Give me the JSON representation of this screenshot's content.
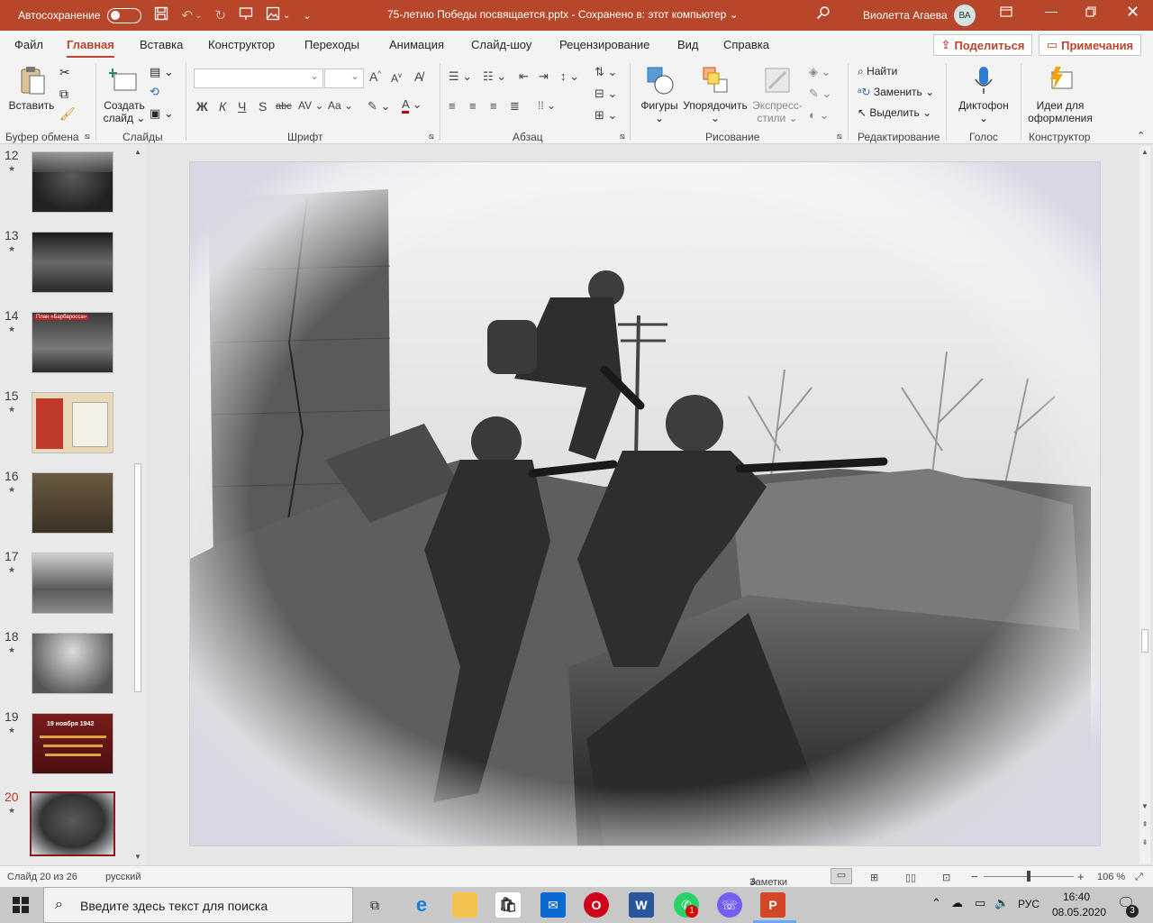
{
  "titlebar": {
    "autosave_label": "Автосохранение",
    "doc_title": "75-летию Победы посвящается.pptx  -  Сохранено в: этот компьютер  ⌄",
    "user_name": "Виолетта Агаева",
    "user_initials": "ВА"
  },
  "tabs": [
    "Файл",
    "Главная",
    "Вставка",
    "Конструктор",
    "Переходы",
    "Анимация",
    "Слайд-шоу",
    "Рецензирование",
    "Вид",
    "Справка"
  ],
  "active_tab": "Главная",
  "share_label": "Поделиться",
  "notes_label": "Примечания",
  "ribbon": {
    "paste": "Вставить",
    "new_slide_1": "Создать",
    "new_slide_2": "слайд",
    "find": "Найти",
    "replace": "Заменить",
    "select": "Выделить",
    "shapes": "Фигуры",
    "arrange": "Упорядочить",
    "quick_styles_1": "Экспресс-",
    "quick_styles_2": "стили",
    "dictate": "Диктофон",
    "ideas_1": "Идеи для",
    "ideas_2": "оформления",
    "bold": "Ж",
    "italic": "К",
    "underline": "Ч",
    "shadow": "S",
    "strike": "abc",
    "groups": {
      "clipboard": "Буфер обмена",
      "slides": "Слайды",
      "font": "Шрифт",
      "paragraph": "Абзац",
      "drawing": "Рисование",
      "editing": "Редактирование",
      "voice": "Голос",
      "designer": "Конструктор"
    }
  },
  "thumbnails": [
    {
      "num": "12",
      "caption": ""
    },
    {
      "num": "13",
      "caption": ""
    },
    {
      "num": "14",
      "caption": "План «Барбаросса»"
    },
    {
      "num": "15",
      "caption": ""
    },
    {
      "num": "16",
      "caption": ""
    },
    {
      "num": "17",
      "caption": ""
    },
    {
      "num": "18",
      "caption": ""
    },
    {
      "num": "19",
      "caption": "19 ноября 1942"
    },
    {
      "num": "20",
      "caption": ""
    }
  ],
  "selected_slide": "20",
  "status": {
    "slide_info": "Слайд 20 из 26",
    "language": "русский",
    "notes": "Заметки",
    "zoom": "106 %"
  },
  "taskbar": {
    "search_placeholder": "Введите здесь текст для поиска",
    "lang": "РУС",
    "time": "16:40",
    "date": "08.05.2020",
    "notification_count": "3",
    "whatsapp_badge": "1"
  }
}
